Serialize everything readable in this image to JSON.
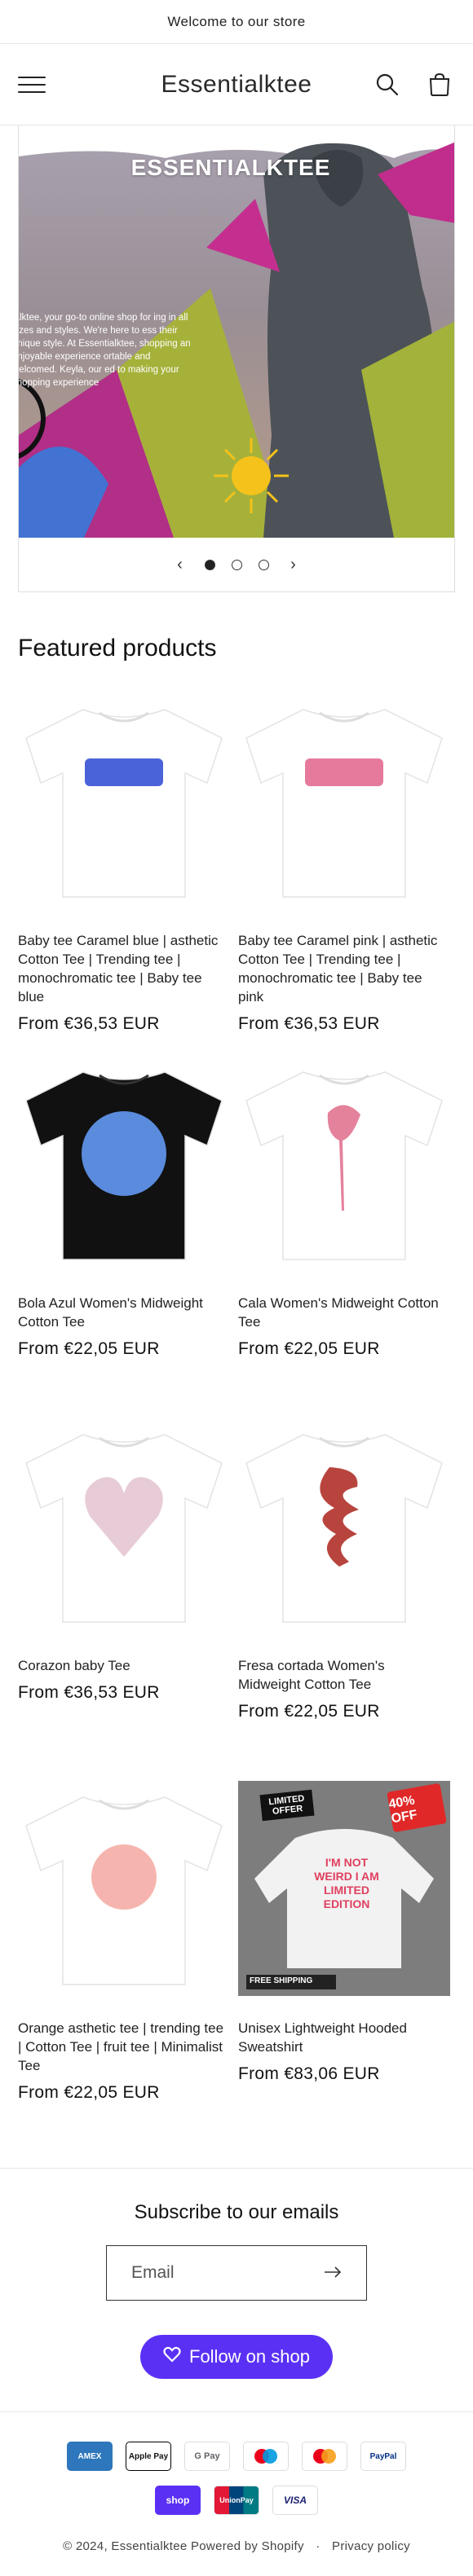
{
  "announcement": "Welcome to our store",
  "header": {
    "brand": "Essentialktee",
    "icons": [
      "hamburger-icon",
      "search-icon",
      "cart-icon"
    ]
  },
  "hero": {
    "heading": "ESSENTIALKTEE",
    "description": "ialktee, your go-to online shop for ing in all sizes and styles. We're here to ess their unique style. At Essentialktee, shopping an enjoyable experience ortable and welcomed. Keyla, our ed to making your shopping experience",
    "prev_icon": "‹",
    "next_icon": "›",
    "slides_total": 3,
    "active_slide": 1
  },
  "featured": {
    "title": "Featured products",
    "products": [
      {
        "title": "Baby tee Caramel blue | asthetic Cotton Tee | Trending tee | monochromatic tee | Baby tee blue",
        "price": "From €36,53 EUR",
        "shirt": "#ffffff",
        "print": "#4b63d8"
      },
      {
        "title": "Baby tee Caramel pink | asthetic Cotton Tee | Trending tee | monochromatic tee | Baby tee pink",
        "price": "From €36,53 EUR",
        "shirt": "#ffffff",
        "print": "#e57a9c"
      },
      {
        "title": "Bola Azul Women's Midweight Cotton Tee",
        "price": "From €22,05 EUR",
        "shirt": "#111111",
        "print": "#5a8bdc"
      },
      {
        "title": "Cala Women's Midweight Cotton Tee",
        "price": "From €22,05 EUR",
        "shirt": "#ffffff",
        "print": "#e4829b"
      },
      {
        "title": "Corazon baby Tee",
        "price": "From €36,53 EUR",
        "shirt": "#ffffff",
        "print": "#c98fa6"
      },
      {
        "title": "Fresa cortada Women's Midweight Cotton Tee",
        "price": "From €22,05 EUR",
        "shirt": "#ffffff",
        "print": "#b8443e"
      },
      {
        "title": "Orange asthetic tee | trending tee | Cotton Tee | fruit tee | Minimalist Tee",
        "price": "From €22,05 EUR",
        "shirt": "#ffffff",
        "print": "#f2a29a"
      },
      {
        "title": "Unisex Lightweight Hooded Sweatshirt",
        "price": "From €83,06 EUR",
        "shirt": "#f2f2f2",
        "print": "#e0405f",
        "badge": "40% OFF",
        "tag": "LIMITED OFFER",
        "free": "FREE SHIPPING",
        "hoodie_text": "I'M NOT WEIRD I AM LIMITED EDITION"
      }
    ]
  },
  "subscribe": {
    "title": "Subscribe to our emails",
    "placeholder": "Email"
  },
  "follow": {
    "label": "Follow on shop"
  },
  "payments": [
    [
      "AMEX",
      "Apple Pay",
      "G Pay",
      "Maestro",
      "Mastercard",
      "PayPal"
    ],
    [
      "shop",
      "UnionPay",
      "VISA"
    ]
  ],
  "footer": {
    "copyright": "© 2024, Essentialktee",
    "powered": "Powered by Shopify",
    "policy": "Privacy policy"
  },
  "colors": {
    "accent": "#5a31f4",
    "text": "#121212"
  }
}
